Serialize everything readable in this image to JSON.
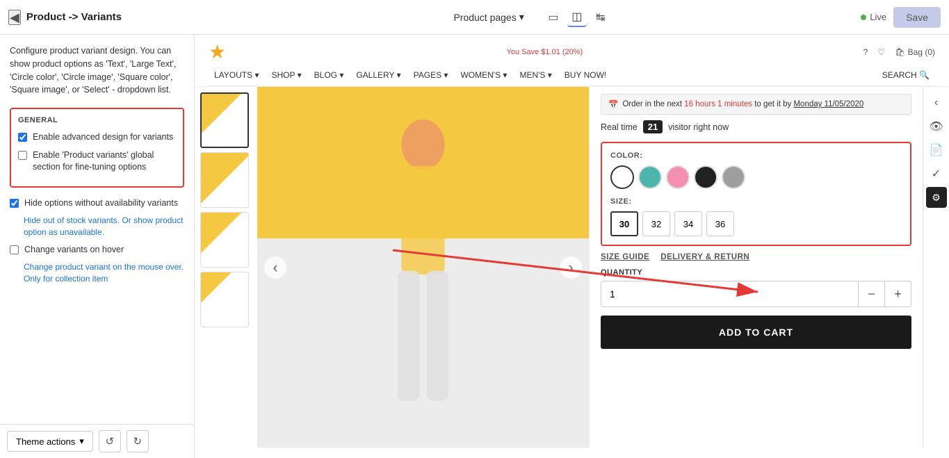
{
  "topbar": {
    "back_icon": "◀",
    "breadcrumb": "Product -> Variants",
    "product_pages": "Product pages",
    "dropdown_icon": "▾",
    "live_label": "Live",
    "save_label": "Save"
  },
  "sidebar": {
    "description": "Configure product variant design. You can show product options as 'Text', 'Large Text', 'Circle color', 'Circle image', 'Square color', 'Square image', or 'Select' - dropdown list.",
    "general_label": "GENERAL",
    "checkboxes": [
      {
        "id": "cb1",
        "label": "Enable advanced design for variants",
        "checked": true
      },
      {
        "id": "cb2",
        "label": "Enable 'Product variants' global section for fine-tuning options",
        "checked": false
      },
      {
        "id": "cb3",
        "label": "Hide options without availability variants",
        "checked": true
      },
      {
        "id": "cb4",
        "label": "Change variants on hover",
        "checked": false
      }
    ],
    "hide_subtext": "Hide out of stock variants. Or show product option as unavailable.",
    "change_subtext": "Change product variant on the mouse over. Only for collection item",
    "theme_actions": "Theme actions"
  },
  "store": {
    "promo": "You Save $1.01 (20%)",
    "bag": "Bag (0)",
    "nav_items": [
      "LAYOUTS",
      "SHOP",
      "BLOG",
      "GALLERY",
      "PAGES",
      "WOMEN'S",
      "MEN'S",
      "BUY NOW!",
      "SEARCH"
    ],
    "delivery_text": "Order in the next",
    "delivery_time": "16 hours 1 minutes",
    "delivery_suffix": "to get it by",
    "delivery_date": "Monday 11/05/2020",
    "realtime_label": "Real time",
    "realtime_count": "21",
    "realtime_suffix": "visitor right now"
  },
  "product": {
    "color_label": "COLOR:",
    "size_label": "SIZE:",
    "sizes": [
      "30",
      "32",
      "34",
      "36"
    ],
    "selected_size": "30",
    "size_guide": "SIZE GUIDE",
    "delivery_return": "DELIVERY & RETURN",
    "quantity_label": "QUANTITY",
    "quantity_value": "1",
    "add_to_cart": "ADD TO CART"
  },
  "bottom_bar": {
    "theme_actions": "Theme actions",
    "dropdown_icon": "▾"
  }
}
